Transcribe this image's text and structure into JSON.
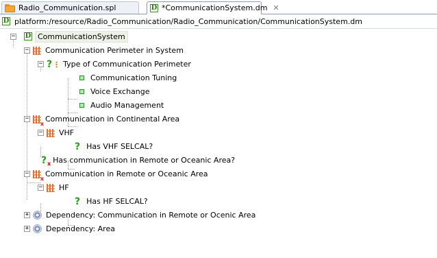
{
  "tabs": [
    {
      "label": "Radio_Communication.spl",
      "icon": "folder-icon"
    },
    {
      "label": "*CommunicationSystem.dm",
      "icon": "dm-file-icon"
    }
  ],
  "path": "platform:/resource/Radio_Communication/Radio_Communication/CommunicationSystem.dm",
  "tree": {
    "root": "CommunicationSystem",
    "n1": "Communication Perimeter in System",
    "n2": "Type of Communication Perimeter",
    "n3": "Communication Tuning",
    "n4": "Voice Exchange",
    "n5": "Audio Management",
    "n6": "Communication in Continental Area",
    "n7": "VHF",
    "n8": "Has VHF SELCAL?",
    "n9": "Has communication in Remote or Oceanic Area?",
    "n10": "Communication in Remote or Oceanic Area",
    "n11": "HF",
    "n12": "Has HF SELCAL?",
    "n13": "Dependency: Communication in Remote or Ocenic Area",
    "n14": "Dependency: Area"
  },
  "icons": {
    "feature": "feature-group-icon",
    "question": "question-icon",
    "value": "value-icon",
    "dependency": "dependency-gear-icon"
  }
}
